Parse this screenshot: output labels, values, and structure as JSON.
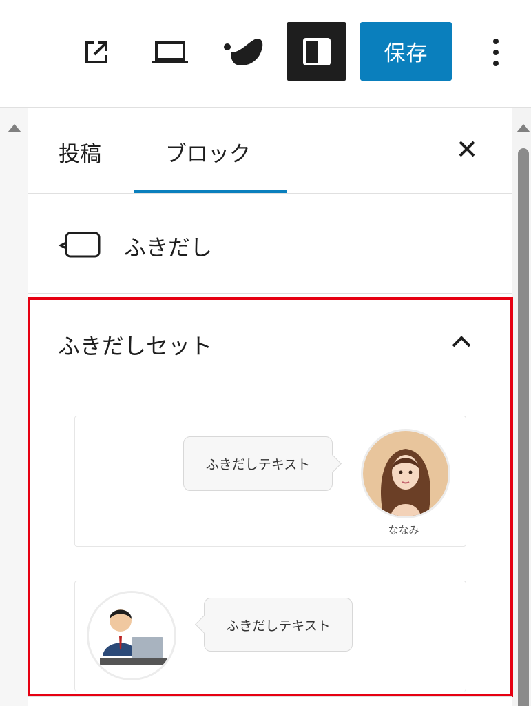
{
  "toolbar": {
    "preview_icon": "external-link-icon",
    "device_icon": "laptop-icon",
    "jetpack_icon": "jetpack-icon",
    "settings_icon": "sidebar-toggle-icon",
    "save_label": "保存",
    "more_icon": "more-vertical-icon"
  },
  "sidebar": {
    "tabs": [
      {
        "label": "投稿"
      },
      {
        "label": "ブロック"
      }
    ],
    "close_icon": "close-icon"
  },
  "block": {
    "icon": "speech-bubble-icon",
    "title": "ふきだし"
  },
  "panel": {
    "title": "ふきだしセット",
    "toggle_icon": "chevron-up-icon",
    "sets": [
      {
        "text": "ふきだしテキスト",
        "avatar_name": "ななみ",
        "avatar_position": "right"
      },
      {
        "text": "ふきだしテキスト",
        "avatar_position": "left"
      }
    ]
  },
  "colors": {
    "accent": "#0a7fbd",
    "highlight_border": "#e60012",
    "dark_button": "#1e1e1e"
  }
}
